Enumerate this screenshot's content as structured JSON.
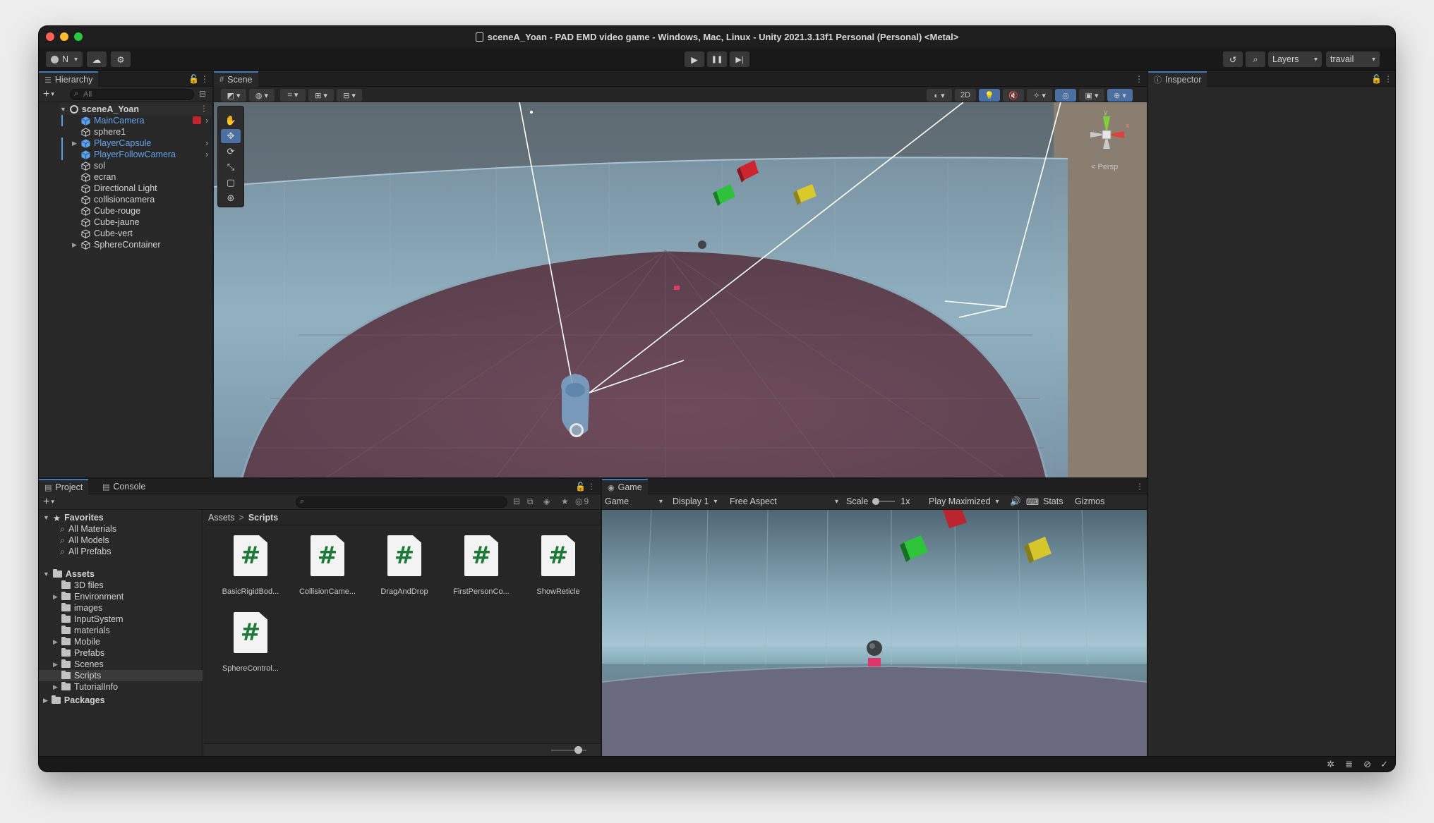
{
  "window": {
    "title": "sceneA_Yoan - PAD EMD video game - Windows, Mac, Linux - Unity 2021.3.13f1 Personal (Personal) <Metal>"
  },
  "toolbar": {
    "account_label": "N",
    "layers_label": "Layers",
    "layout_label": "travail"
  },
  "hierarchy": {
    "tab_label": "Hierarchy",
    "search_placeholder": "All",
    "scene_name": "sceneA_Yoan",
    "items": [
      {
        "label": "MainCamera",
        "prefab": true
      },
      {
        "label": "sphere1",
        "prefab": false
      },
      {
        "label": "PlayerCapsule",
        "prefab": true
      },
      {
        "label": "PlayerFollowCamera",
        "prefab": true
      },
      {
        "label": "sol",
        "prefab": false
      },
      {
        "label": "ecran",
        "prefab": false
      },
      {
        "label": "Directional Light",
        "prefab": false
      },
      {
        "label": "collisioncamera",
        "prefab": false
      },
      {
        "label": "Cube-rouge",
        "prefab": false
      },
      {
        "label": "Cube-jaune",
        "prefab": false
      },
      {
        "label": "Cube-vert",
        "prefab": false
      },
      {
        "label": "SphereContainer",
        "prefab": false
      }
    ]
  },
  "scene": {
    "tab_label": "Scene",
    "btn_2d": "2D",
    "persp_label": "< Persp",
    "gizmo_x": "x",
    "gizmo_y": "y"
  },
  "inspector": {
    "tab_label": "Inspector"
  },
  "project": {
    "tab_label": "Project",
    "console_tab_label": "Console",
    "hidden_count": "9",
    "favorites_label": "Favorites",
    "favorites": [
      "All Materials",
      "All Models",
      "All Prefabs"
    ],
    "assets_label": "Assets",
    "folders": [
      "3D files",
      "Environment",
      "images",
      "InputSystem",
      "materials",
      "Mobile",
      "Prefabs",
      "Scenes",
      "Scripts",
      "TutorialInfo"
    ],
    "packages_label": "Packages",
    "breadcrumb_root": "Assets",
    "breadcrumb_sep": ">",
    "breadcrumb_current": "Scripts",
    "scripts": [
      "BasicRigidBod...",
      "CollisionCame...",
      "DragAndDrop",
      "FirstPersonCo...",
      "ShowReticle",
      "SphereControl..."
    ],
    "script_glyph": "#"
  },
  "game": {
    "tab_label": "Game",
    "mode": "Game",
    "display": "Display 1",
    "aspect": "Free Aspect",
    "scale_label": "Scale",
    "scale_value": "1x",
    "play_mode": "Play Maximized",
    "stats_label": "Stats",
    "gizmos_label": "Gizmos"
  },
  "colors": {
    "accent": "#3a79bb",
    "prefab_blue": "#66a3ea",
    "script_green": "#1c7a36"
  }
}
